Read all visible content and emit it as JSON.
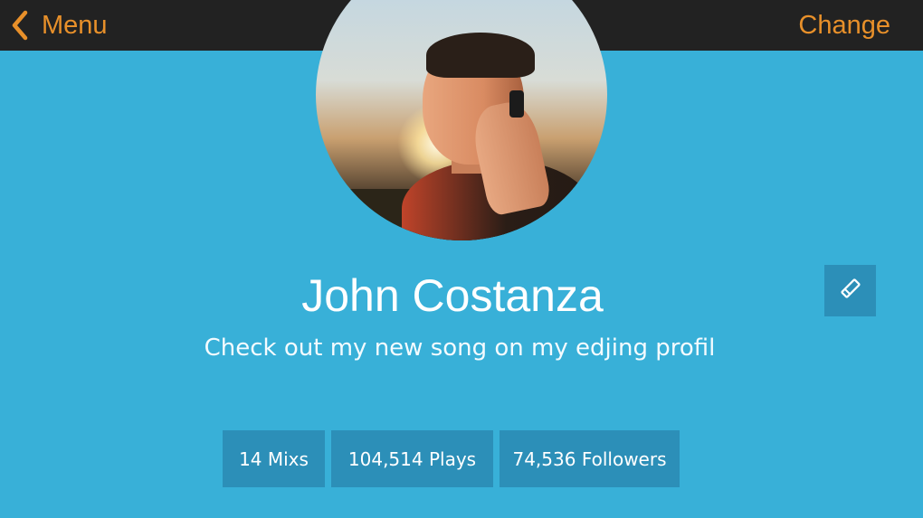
{
  "header": {
    "back_label": "Menu",
    "change_label": "Change"
  },
  "profile": {
    "name": "John Costanza",
    "status": "Check out my new song on my edjing profil"
  },
  "stats": {
    "mixes": "14 Mixs",
    "plays": "104,514 Plays",
    "followers": "74,536 Followers"
  },
  "icons": {
    "back": "chevron-left-icon",
    "edit": "pencil-icon"
  },
  "colors": {
    "background": "#38b0d8",
    "topbar": "#222222",
    "accent": "#e8902a",
    "button": "#2c8fb8"
  }
}
